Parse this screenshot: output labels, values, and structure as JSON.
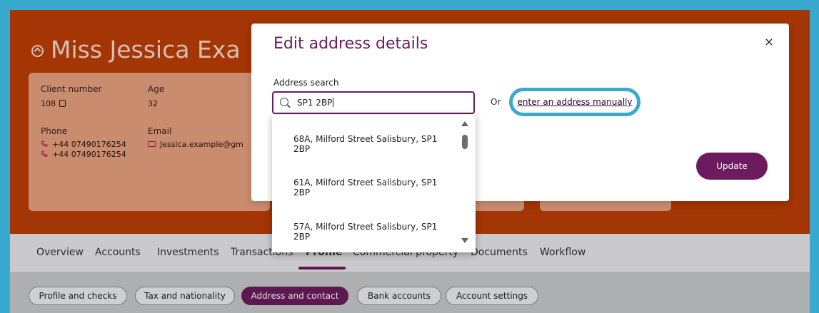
{
  "client": {
    "name": "Miss Jessica Exa",
    "client_number_label": "Client number",
    "client_number": "108",
    "age_label": "Age",
    "age": "32",
    "phone_label": "Phone",
    "phones": [
      "+44 07490176254",
      "+44 07490176254"
    ],
    "email_label": "Email",
    "email": "Jessica.example@gm"
  },
  "tabs": [
    "Overview",
    "Accounts",
    "Investments",
    "Transactions",
    "Profile",
    "Commercial property",
    "Documents",
    "Workflow"
  ],
  "active_tab": "Profile",
  "subtabs": [
    "Profile and checks",
    "Tax and nationality",
    "Address and contact",
    "Bank accounts",
    "Account settings"
  ],
  "active_subtab": "Address and contact",
  "modal": {
    "title": "Edit address details",
    "close": "×",
    "search_label": "Address search",
    "search_value": "SP1 2BP",
    "or_text": "Or",
    "manual_link": "enter an address manually",
    "update": "Update",
    "results": [
      "68A, Milford Street Salisbury, SP1 2BP",
      "61A, Milford Street Salisbury, SP1 2BP",
      "57A, Milford Street Salisbury, SP1 2BP"
    ]
  },
  "colors": {
    "brand_orange": "#bd3d06",
    "brand_purple": "#6b1b5e",
    "highlight_blue": "#3aa9cf"
  }
}
